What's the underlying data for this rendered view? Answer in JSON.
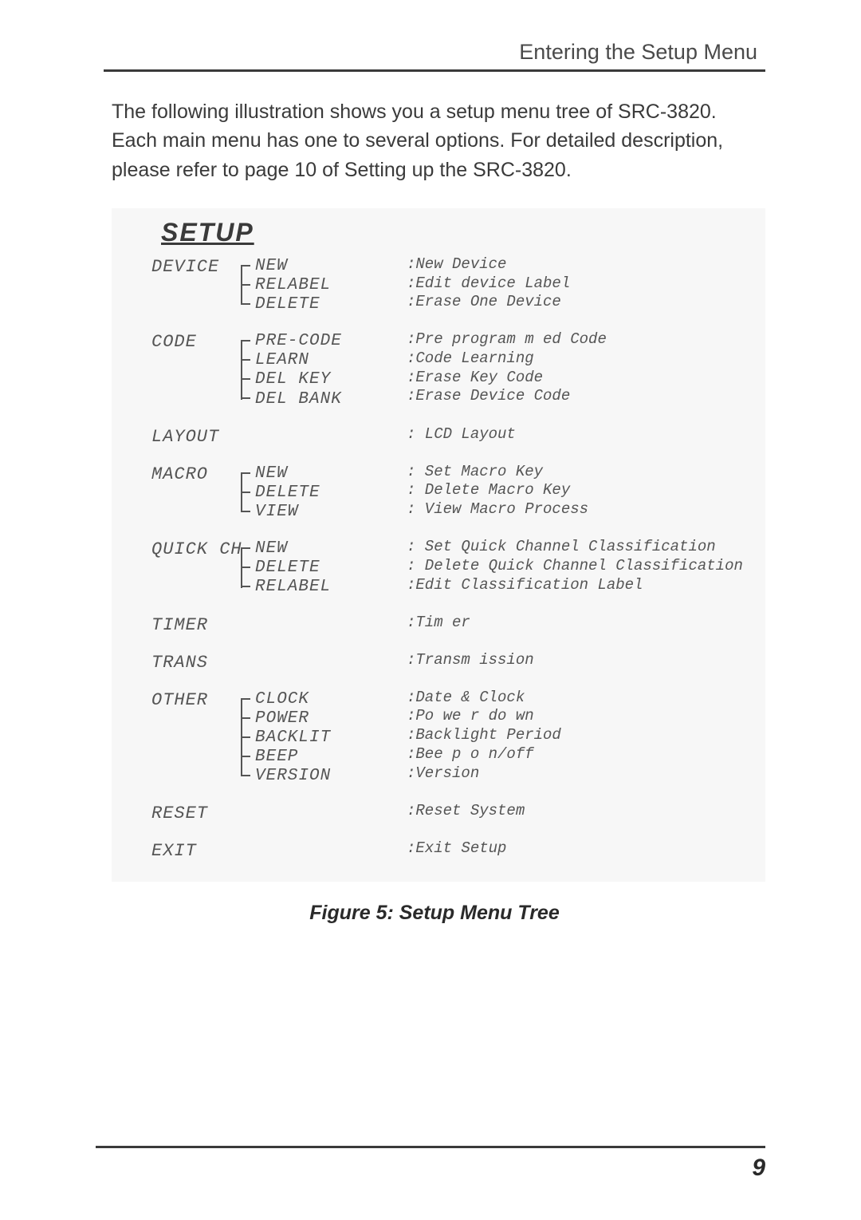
{
  "header": "Entering the Setup Menu",
  "intro": "The following illustration shows you a setup menu tree of SRC-3820. Each main menu has one to several options.  For detailed description, please refer to page 10 of Setting up the SRC-3820.",
  "setup_title": "SETUP",
  "menus": [
    {
      "label": "DEVICE",
      "subs": [
        "NEW",
        "RELABEL",
        "DELETE"
      ],
      "descs": [
        ":New Device",
        ":Edit device Label",
        ":Erase One Device"
      ]
    },
    {
      "label": "CODE",
      "subs": [
        "PRE-CODE",
        "LEARN",
        "DEL KEY",
        "DEL BANK"
      ],
      "descs": [
        ":Pre program m ed  Code",
        ":Code Learning",
        ":Erase Key Code",
        ":Erase Device Code"
      ]
    },
    {
      "label": "LAYOUT",
      "subs": [],
      "descs": [
        ": LCD Layout"
      ]
    },
    {
      "label": "MACRO",
      "subs": [
        "NEW",
        "DELETE",
        "VIEW"
      ],
      "descs": [
        ": Set  Macro Key",
        ": Delete  Macro Key",
        ": View Macro Process"
      ]
    },
    {
      "label": "QUICK CH",
      "subs": [
        "NEW",
        "DELETE",
        "RELABEL"
      ],
      "descs": [
        ": Set Quick Channel  Classification",
        ": Delete Quick Channel  Classification",
        ":Edit Classification Label"
      ]
    },
    {
      "label": "TIMER",
      "subs": [],
      "descs": [
        ":Tim er"
      ]
    },
    {
      "label": "TRANS",
      "subs": [],
      "descs": [
        ":Transm ission"
      ]
    },
    {
      "label": "OTHER",
      "subs": [
        "CLOCK",
        "POWER",
        "BACKLIT",
        "BEEP",
        "VERSION"
      ],
      "descs": [
        ":Date & Clock",
        ":Po we r do wn",
        ":Backlight Period",
        ":Bee p o n/off",
        ":Version"
      ]
    },
    {
      "label": "RESET",
      "subs": [],
      "descs": [
        ":Reset System"
      ]
    },
    {
      "label": "EXIT",
      "subs": [],
      "descs": [
        ":Exit Setup"
      ]
    }
  ],
  "caption": "Figure 5: Setup Menu Tree",
  "page_number": "9"
}
